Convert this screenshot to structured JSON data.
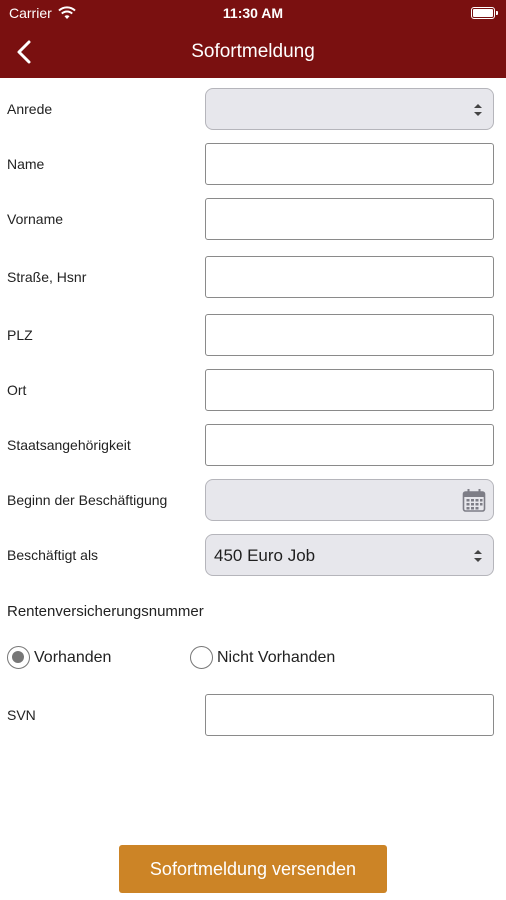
{
  "status_bar": {
    "carrier": "Carrier",
    "time": "11:30 AM"
  },
  "nav": {
    "title": "Sofortmeldung",
    "back_icon": "chevron-left-icon"
  },
  "form": {
    "anrede_label": "Anrede",
    "anrede_value": "",
    "name_label": "Name",
    "name_value": "",
    "vorname_label": "Vorname",
    "vorname_value": "",
    "strasse_label": "Straße, Hsnr",
    "strasse_value": "",
    "plz_label": "PLZ",
    "plz_value": "",
    "ort_label": "Ort",
    "ort_value": "",
    "staat_label": "Staatsangehörigkeit",
    "staat_value": "",
    "beginn_label": "Beginn der Beschäftigung",
    "beginn_value": "",
    "beschaeftigt_label": "Beschäftigt als",
    "beschaeftigt_value": "450 Euro Job",
    "rv_section": "Rentenversicherungsnummer",
    "radio_vorhanden": "Vorhanden",
    "radio_nicht_vorhanden": "Nicht Vorhanden",
    "radio_selected": "Vorhanden",
    "svn_label": "SVN",
    "svn_value": ""
  },
  "submit_label": "Sofortmeldung versenden",
  "colors": {
    "header": "#7a1010",
    "button": "#cc8426"
  }
}
